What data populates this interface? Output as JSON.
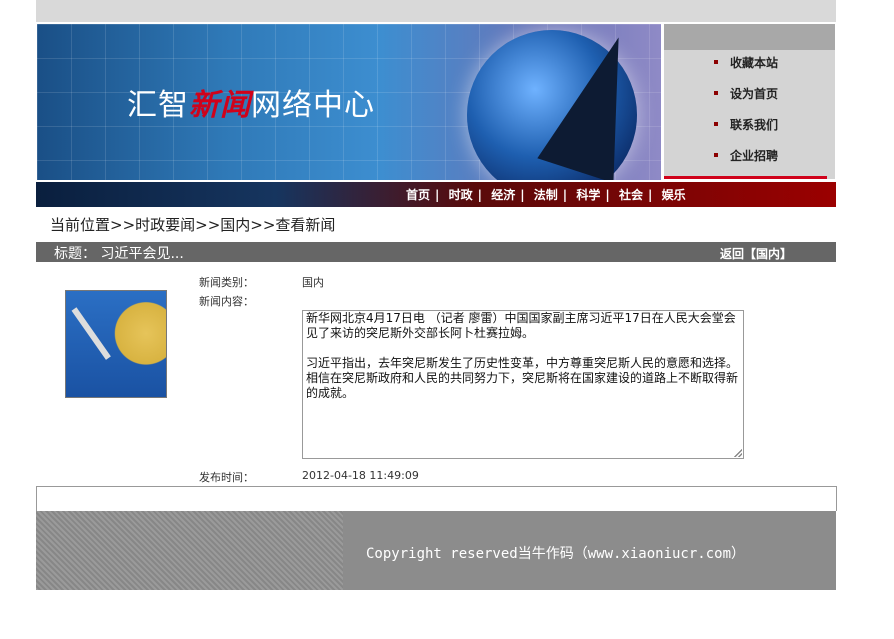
{
  "header": {
    "logo_prefix": "汇智",
    "logo_highlight": "新闻",
    "logo_suffix": "网络中心"
  },
  "side_links": [
    "收藏本站",
    "设为首页",
    "联系我们",
    "企业招聘"
  ],
  "nav": {
    "items": [
      "首页",
      "时政",
      "经济",
      "法制",
      "科学",
      "社会",
      "娱乐"
    ],
    "separator": "|"
  },
  "breadcrumb": "当前位置>>时政要闻>>国内>>查看新闻",
  "article": {
    "title_label": "标题：",
    "title": "习近平会见...",
    "back_label": "返回【国内】",
    "category_label": "新闻类别：",
    "category": "国内",
    "content_label": "新闻内容：",
    "paragraphs": [
      "新华网北京4月17日电 （记者 廖雷）中国国家副主席习近平17日在人民大会堂会见了来访的突尼斯外交部长阿卜杜赛拉姆。",
      "习近平指出，去年突尼斯发生了历史性变革，中方尊重突尼斯人民的意愿和选择。相信在突尼斯政府和人民的共同努力下，突尼斯将在国家建设的道路上不断取得新的成就。"
    ],
    "time_label": "发布时间：",
    "time": "2012-04-18 11:49:09"
  },
  "footer": {
    "copyright": "Copyright reserved当牛作码（www.xiaoniucr.com）"
  }
}
